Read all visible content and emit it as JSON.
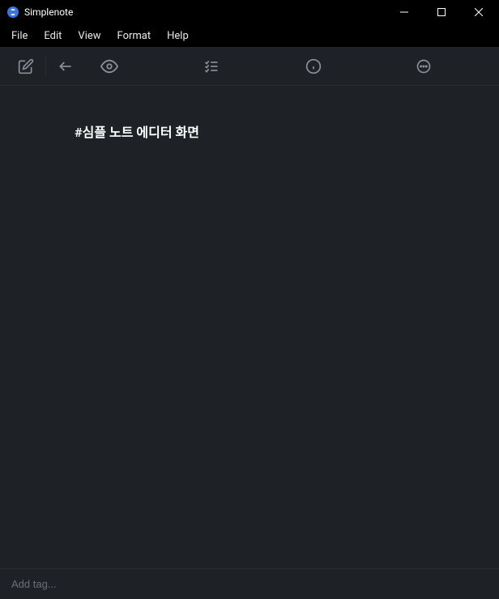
{
  "titlebar": {
    "app_name": "Simplenote"
  },
  "menu": {
    "file": "File",
    "edit": "Edit",
    "view": "View",
    "format": "Format",
    "help": "Help"
  },
  "note": {
    "heading": "#심플 노트 에디터 화면"
  },
  "tagbar": {
    "placeholder": "Add tag..."
  }
}
